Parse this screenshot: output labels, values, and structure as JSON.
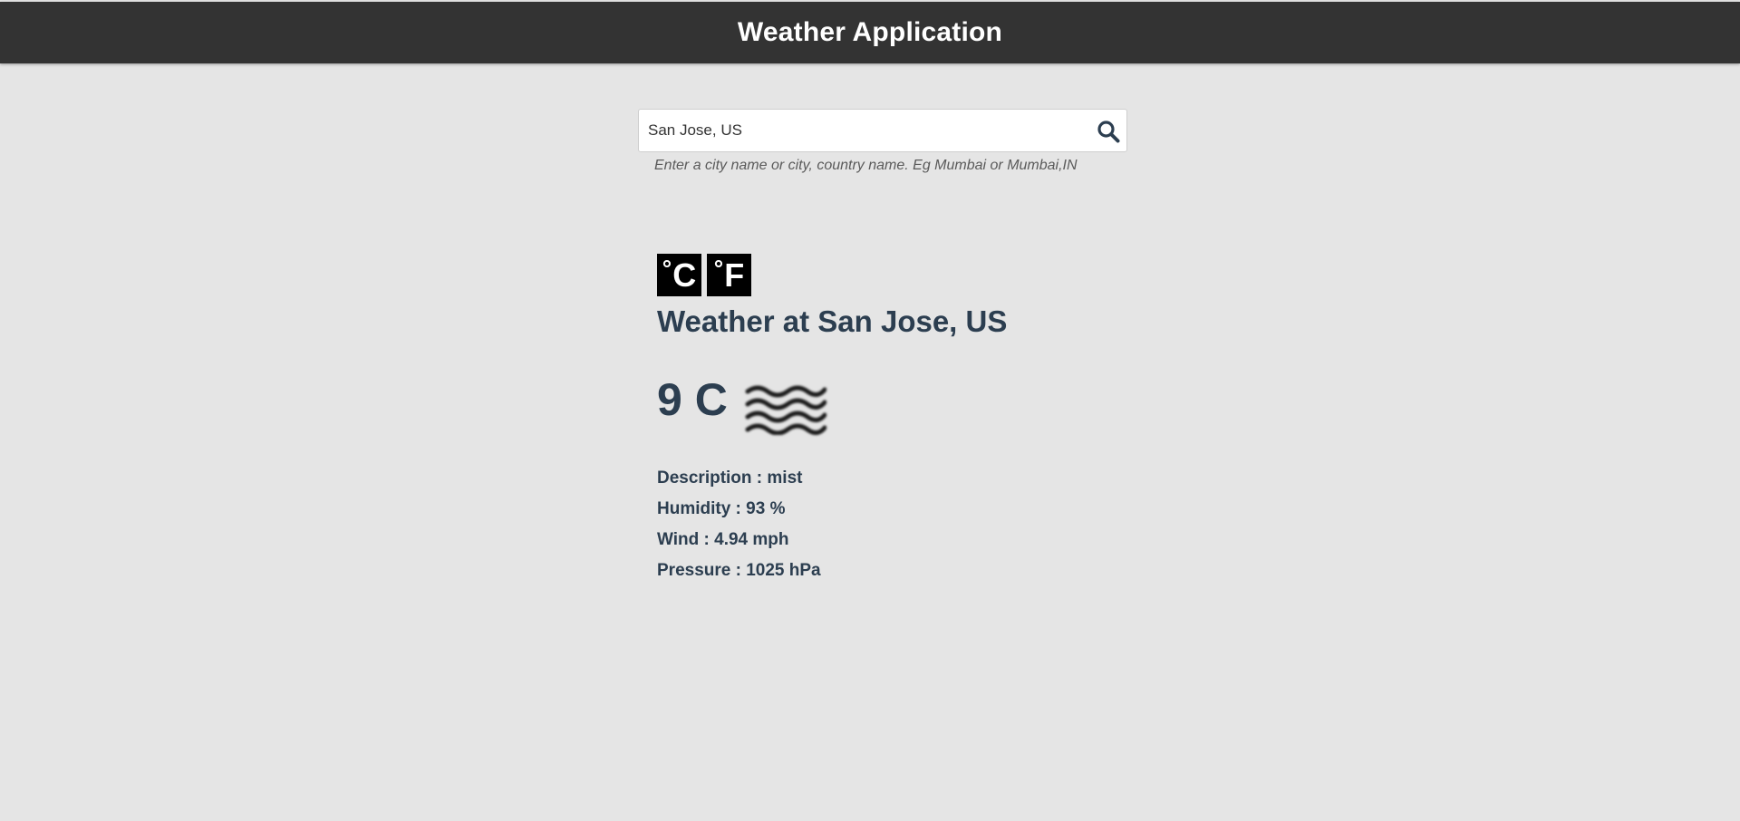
{
  "header": {
    "title": "Weather Application"
  },
  "search": {
    "value": "San Jose, US",
    "hint": "Enter a city name or city, country name. Eg Mumbai or Mumbai,IN"
  },
  "units": {
    "celsius_label": "C",
    "fahrenheit_label": "F",
    "degree_symbol": "°"
  },
  "weather": {
    "title": "Weather at San Jose, US",
    "temperature": "9 C",
    "icon": "mist-icon",
    "details": [
      {
        "text": "Description : mist"
      },
      {
        "text": "Humidity : 93 %"
      },
      {
        "text": "Wind : 4.94 mph"
      },
      {
        "text": "Pressure : 1025 hPa"
      }
    ]
  },
  "colors": {
    "header_bg": "#333333",
    "page_bg": "#e5e5e5",
    "text_primary": "#2c3e50"
  }
}
